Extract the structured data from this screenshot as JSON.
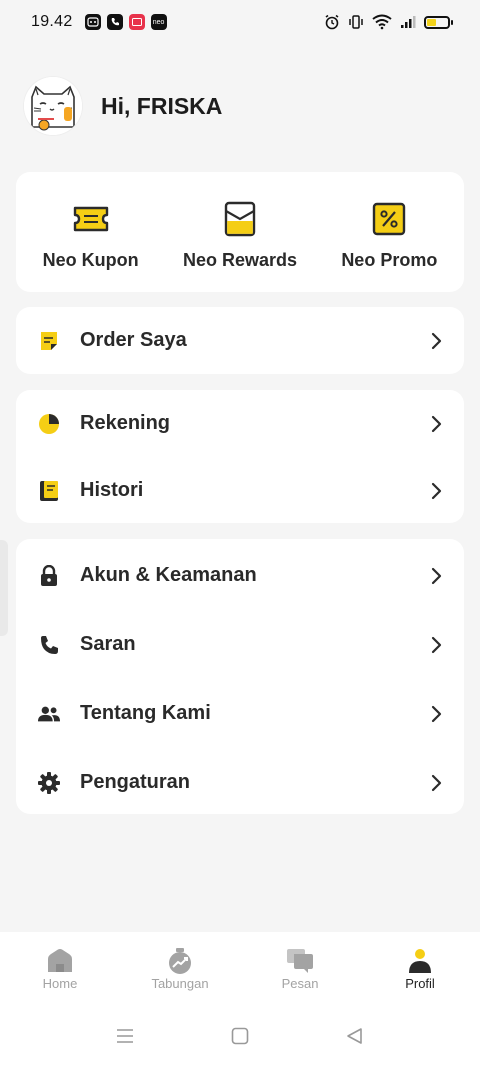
{
  "status_bar": {
    "time": "19.42",
    "notif_icons": [
      "dice-icon",
      "phone-icon",
      "image-icon",
      "neo-app-icon"
    ],
    "notif_neo_label": "neo",
    "right_icons": [
      "alarm-icon",
      "vibrate-icon",
      "wifi-icon",
      "signal-icon",
      "battery-icon"
    ]
  },
  "profile": {
    "greeting": "Hi, FRISKA",
    "avatar_icon": "lucky-cat-avatar"
  },
  "quick_actions": [
    {
      "label": "Neo Kupon",
      "icon": "ticket-icon"
    },
    {
      "label": "Neo Rewards",
      "icon": "envelope-icon"
    },
    {
      "label": "Neo Promo",
      "icon": "percent-tag-icon"
    }
  ],
  "menu_groups": [
    [
      {
        "label": "Order Saya",
        "icon": "note-icon"
      }
    ],
    [
      {
        "label": "Rekening",
        "icon": "pie-chart-icon"
      },
      {
        "label": "Histori",
        "icon": "book-icon"
      }
    ],
    [
      {
        "label": "Akun & Keamanan",
        "icon": "lock-icon"
      },
      {
        "label": "Saran",
        "icon": "phone-icon"
      },
      {
        "label": "Tentang Kami",
        "icon": "people-icon"
      },
      {
        "label": "Pengaturan",
        "icon": "gear-icon"
      }
    ]
  ],
  "bottom_nav": [
    {
      "label": "Home",
      "icon": "home-icon",
      "active": false
    },
    {
      "label": "Tabungan",
      "icon": "savings-icon",
      "active": false
    },
    {
      "label": "Pesan",
      "icon": "chat-icon",
      "active": false
    },
    {
      "label": "Profil",
      "icon": "person-icon",
      "active": true
    }
  ],
  "system_nav": [
    "recents-icon",
    "home-square-icon",
    "back-triangle-icon"
  ],
  "colors": {
    "accent": "#F5CE15",
    "icon_dark": "#2b2b2b",
    "background": "#F5F5F5",
    "card": "#FFFFFF",
    "inactive": "#A3A3A3"
  }
}
